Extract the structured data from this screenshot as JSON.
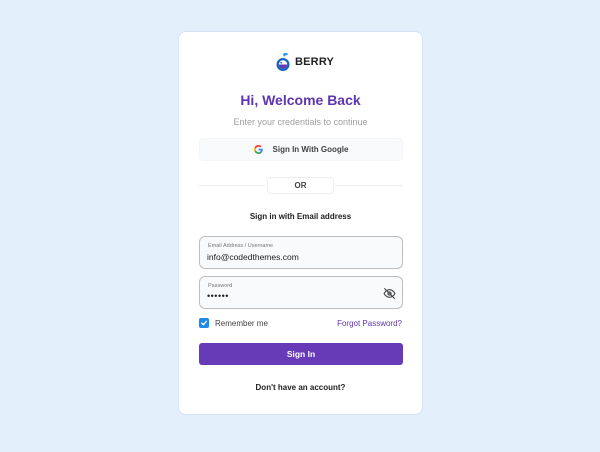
{
  "brand": {
    "name": "BERRY",
    "logo_icon": "berry-logo-icon"
  },
  "header": {
    "title": "Hi, Welcome Back",
    "subtitle": "Enter your credentials to continue"
  },
  "social": {
    "google_label": "Sign In With Google",
    "google_icon": "google-icon"
  },
  "divider": {
    "label": "OR"
  },
  "form": {
    "heading": "Sign in with Email address",
    "email": {
      "label": "Email Address / Username",
      "value": "info@codedthemes.com"
    },
    "password": {
      "label": "Password",
      "value": "••••••",
      "toggle_icon": "eye-off-icon"
    },
    "remember": {
      "label": "Remember me",
      "checked": true
    },
    "forgot_label": "Forgot Password?",
    "submit_label": "Sign In"
  },
  "footer": {
    "no_account_label": "Don't have an account?"
  },
  "colors": {
    "page_background": "#e3f0fc",
    "primary": "#673ab7",
    "title": "#5e35b1",
    "checkbox": "#1e88e5"
  }
}
